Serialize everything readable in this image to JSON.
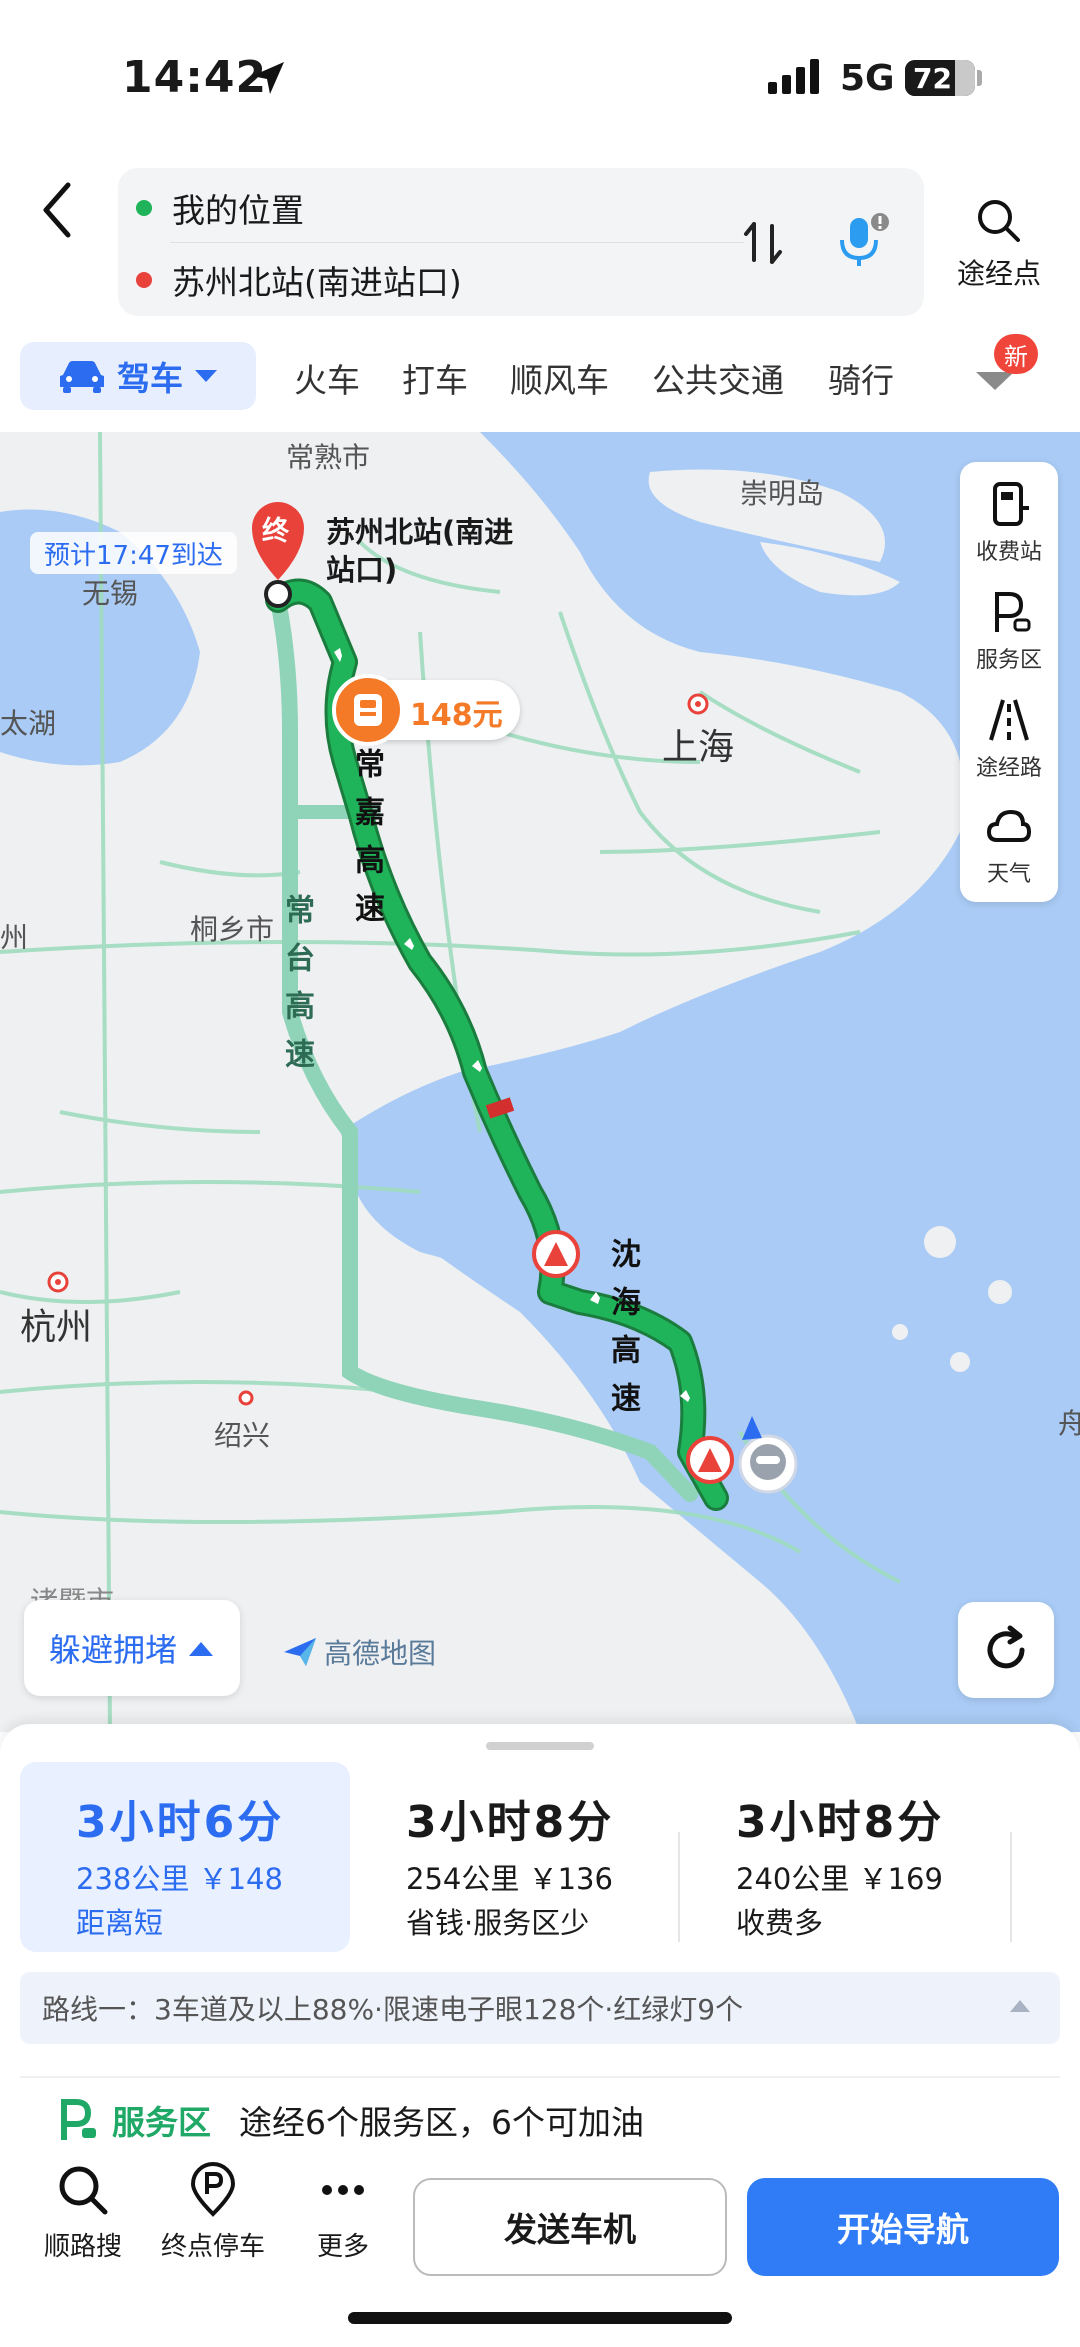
{
  "status": {
    "time": "14:42",
    "network": "5G",
    "battery": "72",
    "battery_level": 0.72
  },
  "header": {
    "origin": "我的位置",
    "destination": "苏州北站(南进站口)",
    "waypoint_label": "途经点"
  },
  "modes": {
    "active": "驾车",
    "tabs": [
      "火车",
      "打车",
      "顺风车",
      "公共交通",
      "骑行"
    ],
    "badge": "新"
  },
  "map": {
    "eta": "预计17:47到达",
    "dest_marker": "终",
    "dest_name": "苏州北站(南进站口)",
    "dest_line1": "苏州北站(南进",
    "dest_line2": "站口)",
    "toll_price": "148元",
    "places": {
      "changshu": "常熟市",
      "chongming": "崇明岛",
      "wuxi": "无锡",
      "taihu": "太湖",
      "shanghai": "上海",
      "tongxiang": "桐乡市",
      "hangzhou": "杭州",
      "shaoxing": "绍兴",
      "zhuji": "诸暨市",
      "zhou": "舟",
      "zhou2": "州"
    },
    "roads": {
      "main": "常嘉高速",
      "alt": "常台高速",
      "second": "沈海高速"
    },
    "tools": [
      "收费站",
      "服务区",
      "途经路",
      "天气"
    ],
    "avoid_label": "躲避拥堵",
    "logo": "高德地图"
  },
  "routes": [
    {
      "time": "3小时6分",
      "distance": "238公里 ￥148",
      "tag": "距离短",
      "selected": true
    },
    {
      "time": "3小时8分",
      "distance": "254公里 ￥136",
      "tag": "省钱·服务区少",
      "selected": false
    },
    {
      "time": "3小时8分",
      "distance": "240公里 ￥169",
      "tag": "收费多",
      "selected": false
    }
  ],
  "route_info": "路线一：3车道及以上88%·限速电子眼128个·红绿灯9个",
  "service": {
    "label": "服务区",
    "text": "途经6个服务区，6个可加油"
  },
  "bottom": {
    "search_along": "顺路搜",
    "end_parking": "终点停车",
    "more": "更多",
    "send_to_car": "发送车机",
    "start_nav": "开始导航"
  },
  "colors": {
    "accent": "#2c6cf0",
    "route_green": "#1fb35a",
    "alt_route": "#8fd4b8",
    "toll_orange": "#f47a28",
    "water": "#a9cbf5"
  }
}
